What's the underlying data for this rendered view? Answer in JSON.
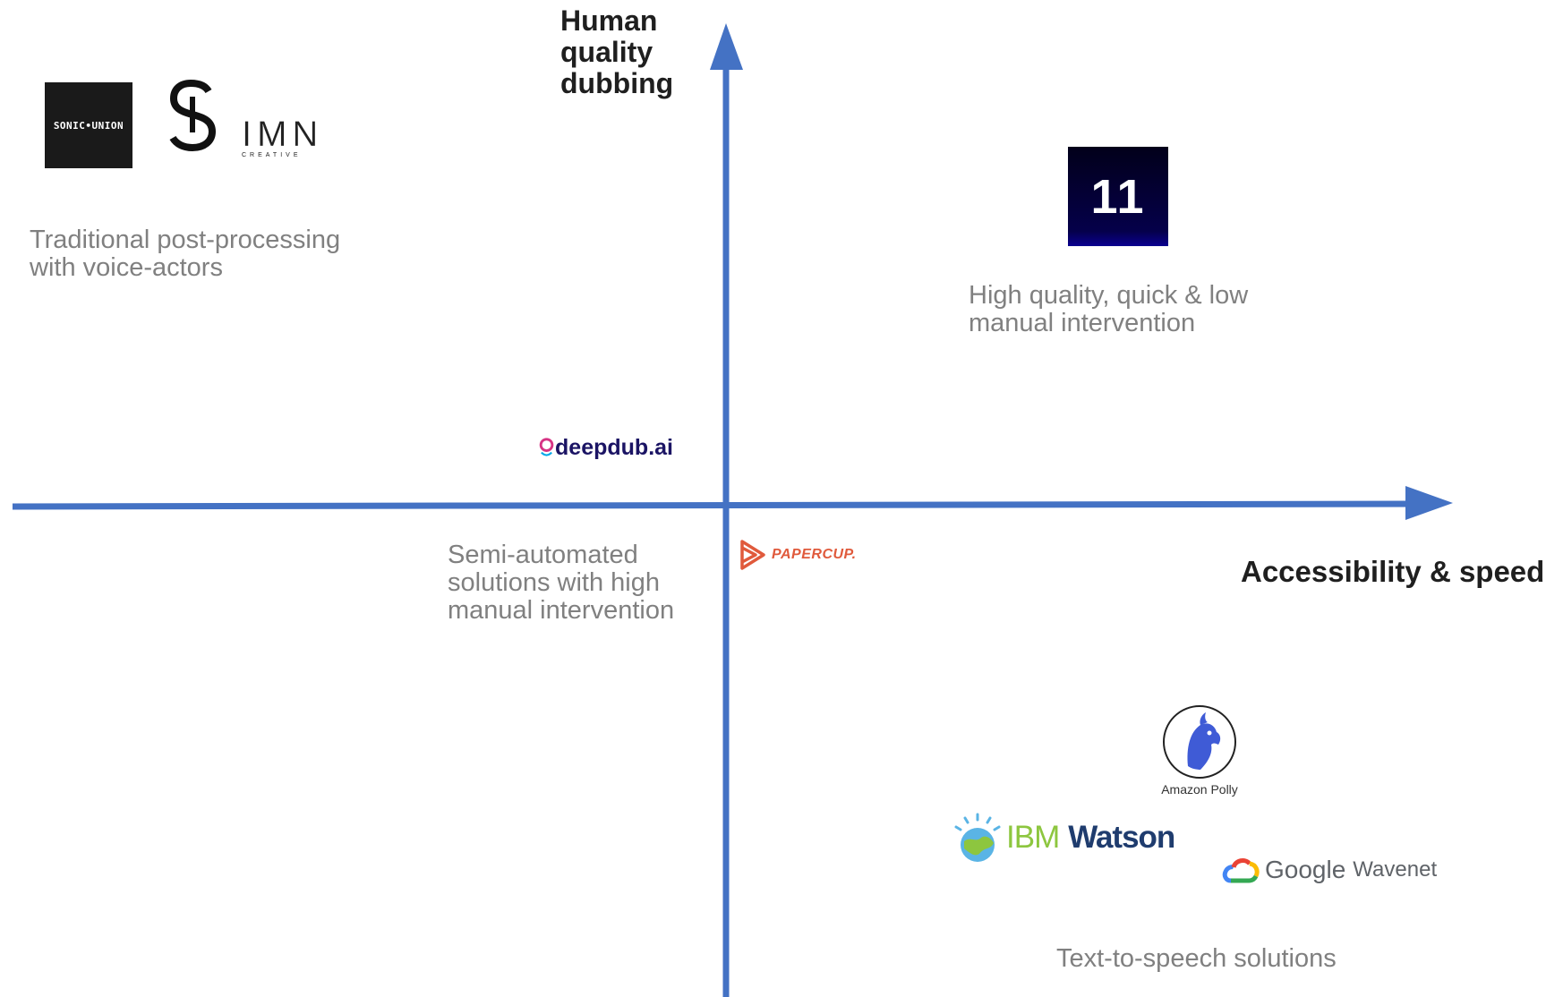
{
  "axes": {
    "y_label_lines": [
      "Human",
      "quality",
      "dubbing"
    ],
    "x_label": "Accessibility & speed",
    "axis_color": "#4472C4"
  },
  "quadrants": {
    "top_left": [
      "Traditional post-processing",
      "with voice-actors"
    ],
    "top_right": [
      "High quality, quick & low",
      "manual intervention"
    ],
    "bottom_left": [
      "Semi-automated",
      "solutions with high",
      "manual intervention"
    ],
    "bottom_right": [
      "Text-to-speech solutions"
    ]
  },
  "logos": {
    "sonic_union": "SONIC•UNION",
    "s_logo": "S",
    "imn": "IMN",
    "imn_sub": "CREATIVE",
    "eleven": "11",
    "deepdub": "deepdub.ai",
    "papercup": "PAPERCUP.",
    "amazon_polly": "Amazon Polly",
    "ibm": "IBM",
    "watson": "Watson",
    "google": "Google",
    "wavenet": "Wavenet"
  },
  "colors": {
    "text_gray": "#808080",
    "papercup": "#E05A3C",
    "deepdub": "#1B1464",
    "polly": "#3F5BD6",
    "ibm_green": "#8DC63F",
    "watson_navy": "#1F3C6E"
  }
}
